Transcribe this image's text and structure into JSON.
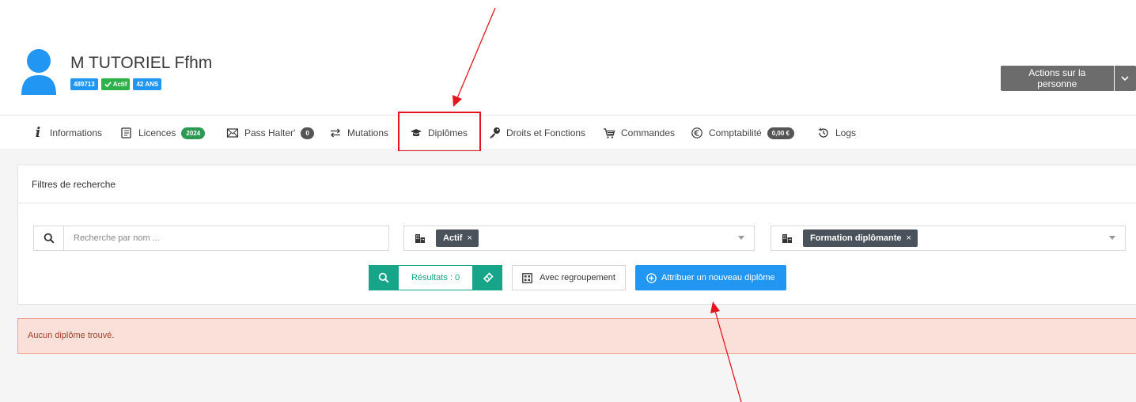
{
  "person": {
    "name": "M TUTORIEL Ffhm",
    "badges": {
      "id": "489713",
      "status": "Actif",
      "age": "42 ANS"
    }
  },
  "actions": {
    "label": "Actions sur la personne"
  },
  "tabs": [
    {
      "label": "Informations",
      "icon": "info-icon"
    },
    {
      "label": "Licences",
      "icon": "licence-icon",
      "badge": "2024"
    },
    {
      "label": "Pass Halter'",
      "icon": "pass-icon",
      "badge": "0"
    },
    {
      "label": "Mutations",
      "icon": "transfer-arrows-icon"
    },
    {
      "label": "Diplômes",
      "icon": "graduation-cap-icon",
      "active": true
    },
    {
      "label": "Droits et Fonctions",
      "icon": "key-icon"
    },
    {
      "label": "Commandes",
      "icon": "cart-icon"
    },
    {
      "label": "Comptabilité",
      "icon": "euro-icon",
      "badge": "0,00 €"
    },
    {
      "label": "Logs",
      "icon": "history-icon"
    }
  ],
  "filters": {
    "title": "Filtres de recherche",
    "search_placeholder": "Recherche par nom ...",
    "status_chip": "Actif",
    "type_chip": "Formation diplômante",
    "chip_remove": "×"
  },
  "buttons": {
    "results": "Résultats : 0",
    "grouping": "Avec regroupement",
    "assign": "Attribuer un nouveau diplôme"
  },
  "alert": {
    "message": "Aucun diplôme trouvé."
  },
  "colors": {
    "primary": "#2196f3",
    "teal": "#17a589",
    "success": "#2db24a",
    "danger_bg": "#fbe0d9",
    "annotation": "#e3161e"
  }
}
